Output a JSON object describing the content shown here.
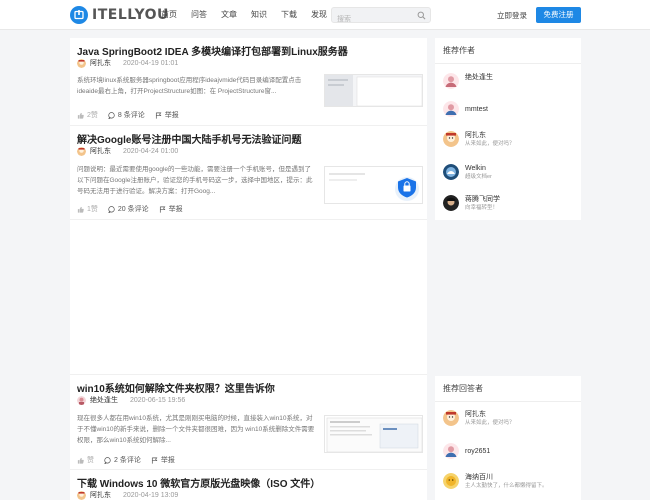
{
  "header": {
    "logo_text": "ITELLYOU",
    "nav": [
      "首页",
      "问答",
      "文章",
      "知识",
      "下载",
      "发现"
    ],
    "search_placeholder": "搜索",
    "login": "立即登录",
    "register": "免费注册",
    "accent": "#1e88e5"
  },
  "articles": [
    {
      "title": "Java SpringBoot2 IDEA 多模块编译打包部署到Linux服务器",
      "author": "阿扎东",
      "date": "2020-04-19 01:01",
      "excerpt": "系统环境linux系统服务器springboot应用程序ideajvmide代码目录编译配置点击ideaide最右上角，打开ProjectStructure如图：在 ProjectStructure窗...",
      "likes": "2赞",
      "comments": "8 条评论",
      "report": "举报"
    },
    {
      "title": "解决Google账号注册中国大陆手机号无法验证问题",
      "author": "阿扎东",
      "date": "2020-04-24 01:00",
      "excerpt": "问题说明：最近需要使用google的一些功能，需要注册一个手机账号，但是遇到了以下问题在Google注册账户，验证您的手机号码这一步，选择中国地区，提示：此号码无法用于进行验证。解决方案：打开Goog...",
      "likes": "1赞",
      "comments": "20 条评论",
      "report": "举报"
    },
    {
      "title": "win10系统如何解除文件夹权限？这里告诉你",
      "author": "绝处逢生",
      "date": "2020-06-15 19:56",
      "excerpt": "现在很多人都在用win10系统，尤其是刚刚买电脑的时候，直接装入win10系统，对于不懂win10的新手来说，删除一个文件夹都很困难，因为 win10系统删除文件需要权限，那么win10系统如何解除...",
      "likes": "赞",
      "comments": "2 条评论",
      "report": "举报"
    },
    {
      "title": "下载 Windows 10 微软官方原版光盘映像（ISO 文件）",
      "author": "阿扎东",
      "date": "2020-04-19 13:09"
    }
  ],
  "authors_box": {
    "title": "推荐作者",
    "items": [
      {
        "name": "绝处逢生",
        "sub": ""
      },
      {
        "name": "mmtest",
        "sub": ""
      },
      {
        "name": "阿扎东",
        "sub": "从来如此，便对吗？"
      },
      {
        "name": "Welkin",
        "sub": "超级文档er"
      },
      {
        "name": "蒋腾飞同学",
        "sub": "向幸福转型！"
      }
    ]
  },
  "answerers_box": {
    "title": "推荐回答者",
    "items": [
      {
        "name": "阿扎东",
        "sub": "从来如此，便对吗？"
      },
      {
        "name": "roy2651",
        "sub": ""
      },
      {
        "name": "海纳百川",
        "sub": "主人太勤快了，什么都懒得留下。"
      }
    ]
  }
}
